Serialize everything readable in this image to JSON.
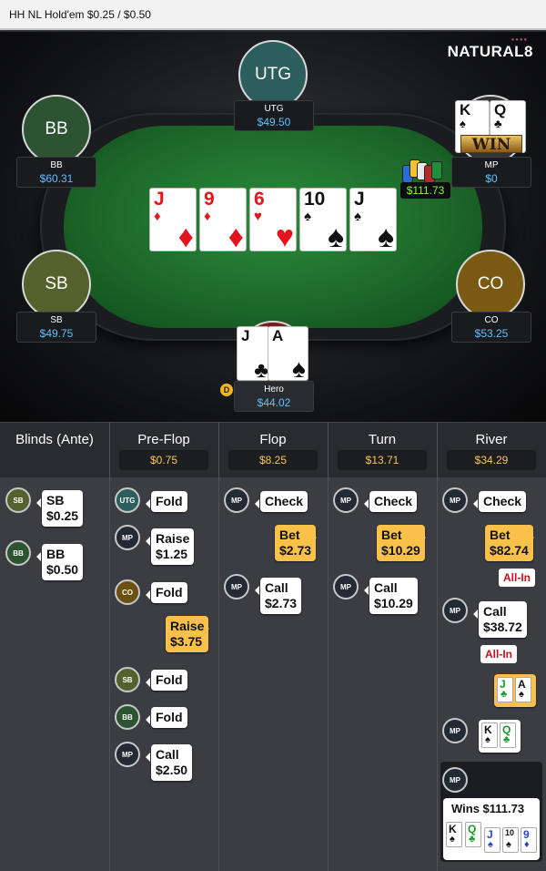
{
  "app": {
    "title": "HH NL Hold'em $0.25 / $0.50",
    "brand": "NATURAL8"
  },
  "colors": {
    "felt": "#1d6a2a",
    "stack": "#5ec0ff",
    "pot": "#8bf54a",
    "street_pot": "#f7c55a",
    "bet_bubble": "#f9c14a",
    "allin": "#c1121f"
  },
  "seats": {
    "utg": {
      "label": "UTG",
      "name": "UTG",
      "stack": "$49.50",
      "color": "#2d5e5e"
    },
    "bb": {
      "label": "BB",
      "name": "BB",
      "stack": "$60.31",
      "color": "#2c5433"
    },
    "mp": {
      "name": "MP",
      "stack": "$0"
    },
    "sb": {
      "label": "SB",
      "name": "SB",
      "stack": "$49.75",
      "color": "#56602c"
    },
    "co": {
      "label": "CO",
      "name": "CO",
      "stack": "$53.25",
      "color": "#7a5a12"
    },
    "hero": {
      "name": "Hero",
      "stack": "$44.02",
      "dealer": "D"
    }
  },
  "mp_hole": [
    {
      "rank": "K",
      "suit": "♠"
    },
    {
      "rank": "Q",
      "suit": "♣"
    }
  ],
  "mp_win_badge": "WIN",
  "hero_hole": [
    {
      "rank": "J",
      "suit": "♣"
    },
    {
      "rank": "A",
      "suit": "♠"
    }
  ],
  "board": [
    {
      "rank": "J",
      "suit": "♦"
    },
    {
      "rank": "9",
      "suit": "♦"
    },
    {
      "rank": "6",
      "suit": "♥"
    },
    {
      "rank": "10",
      "suit": "♠"
    },
    {
      "rank": "J",
      "suit": "♠"
    }
  ],
  "pot": "$111.73",
  "streets": [
    {
      "name": "Blinds (Ante)",
      "pot": ""
    },
    {
      "name": "Pre-Flop",
      "pot": "$0.75"
    },
    {
      "name": "Flop",
      "pot": "$8.25"
    },
    {
      "name": "Turn",
      "pot": "$13.71"
    },
    {
      "name": "River",
      "pot": "$34.29"
    }
  ],
  "blinds": [
    {
      "pos": "SB",
      "action": "SB",
      "amount": "$0.25"
    },
    {
      "pos": "BB",
      "action": "BB",
      "amount": "$0.50"
    }
  ],
  "preflop": [
    {
      "pos": "UTG",
      "action": "Fold",
      "amount": ""
    },
    {
      "pos": "MP",
      "action": "Raise",
      "amount": "$1.25"
    },
    {
      "pos": "CO",
      "action": "Fold",
      "amount": ""
    },
    {
      "pos": "",
      "action": "Raise",
      "amount": "$3.75"
    },
    {
      "pos": "SB",
      "action": "Fold",
      "amount": ""
    },
    {
      "pos": "BB",
      "action": "Fold",
      "amount": ""
    },
    {
      "pos": "MP",
      "action": "Call",
      "amount": "$2.50"
    }
  ],
  "flop": [
    {
      "pos": "MP",
      "action": "Check",
      "amount": ""
    },
    {
      "pos": "",
      "action": "Bet",
      "amount": "$2.73"
    },
    {
      "pos": "MP",
      "action": "Call",
      "amount": "$2.73"
    }
  ],
  "turn": [
    {
      "pos": "MP",
      "action": "Check",
      "amount": ""
    },
    {
      "pos": "",
      "action": "Bet",
      "amount": "$10.29"
    },
    {
      "pos": "MP",
      "action": "Call",
      "amount": "$10.29"
    }
  ],
  "river": [
    {
      "pos": "MP",
      "action": "Check",
      "amount": ""
    },
    {
      "pos": "",
      "action": "Bet",
      "amount": "$82.74",
      "tag": "All-In"
    },
    {
      "pos": "MP",
      "action": "Call",
      "amount": "$38.72",
      "tag": "All-In"
    }
  ],
  "showdown": {
    "hero_cards": [
      {
        "rank": "J",
        "suit": "♣"
      },
      {
        "rank": "A",
        "suit": "♠"
      }
    ],
    "mp_pos": "MP",
    "mp_cards": [
      {
        "rank": "K",
        "suit": "♠"
      },
      {
        "rank": "Q",
        "suit": "♣"
      }
    ],
    "winner_pos": "MP",
    "winner_text": "Wins $111.73",
    "winning_hand": [
      {
        "rank": "K",
        "suit": "♠"
      },
      {
        "rank": "Q",
        "suit": "♣"
      },
      {
        "rank": "J",
        "suit": "♠"
      },
      {
        "rank": "10",
        "suit": "♠"
      },
      {
        "rank": "9",
        "suit": "♦"
      }
    ]
  }
}
